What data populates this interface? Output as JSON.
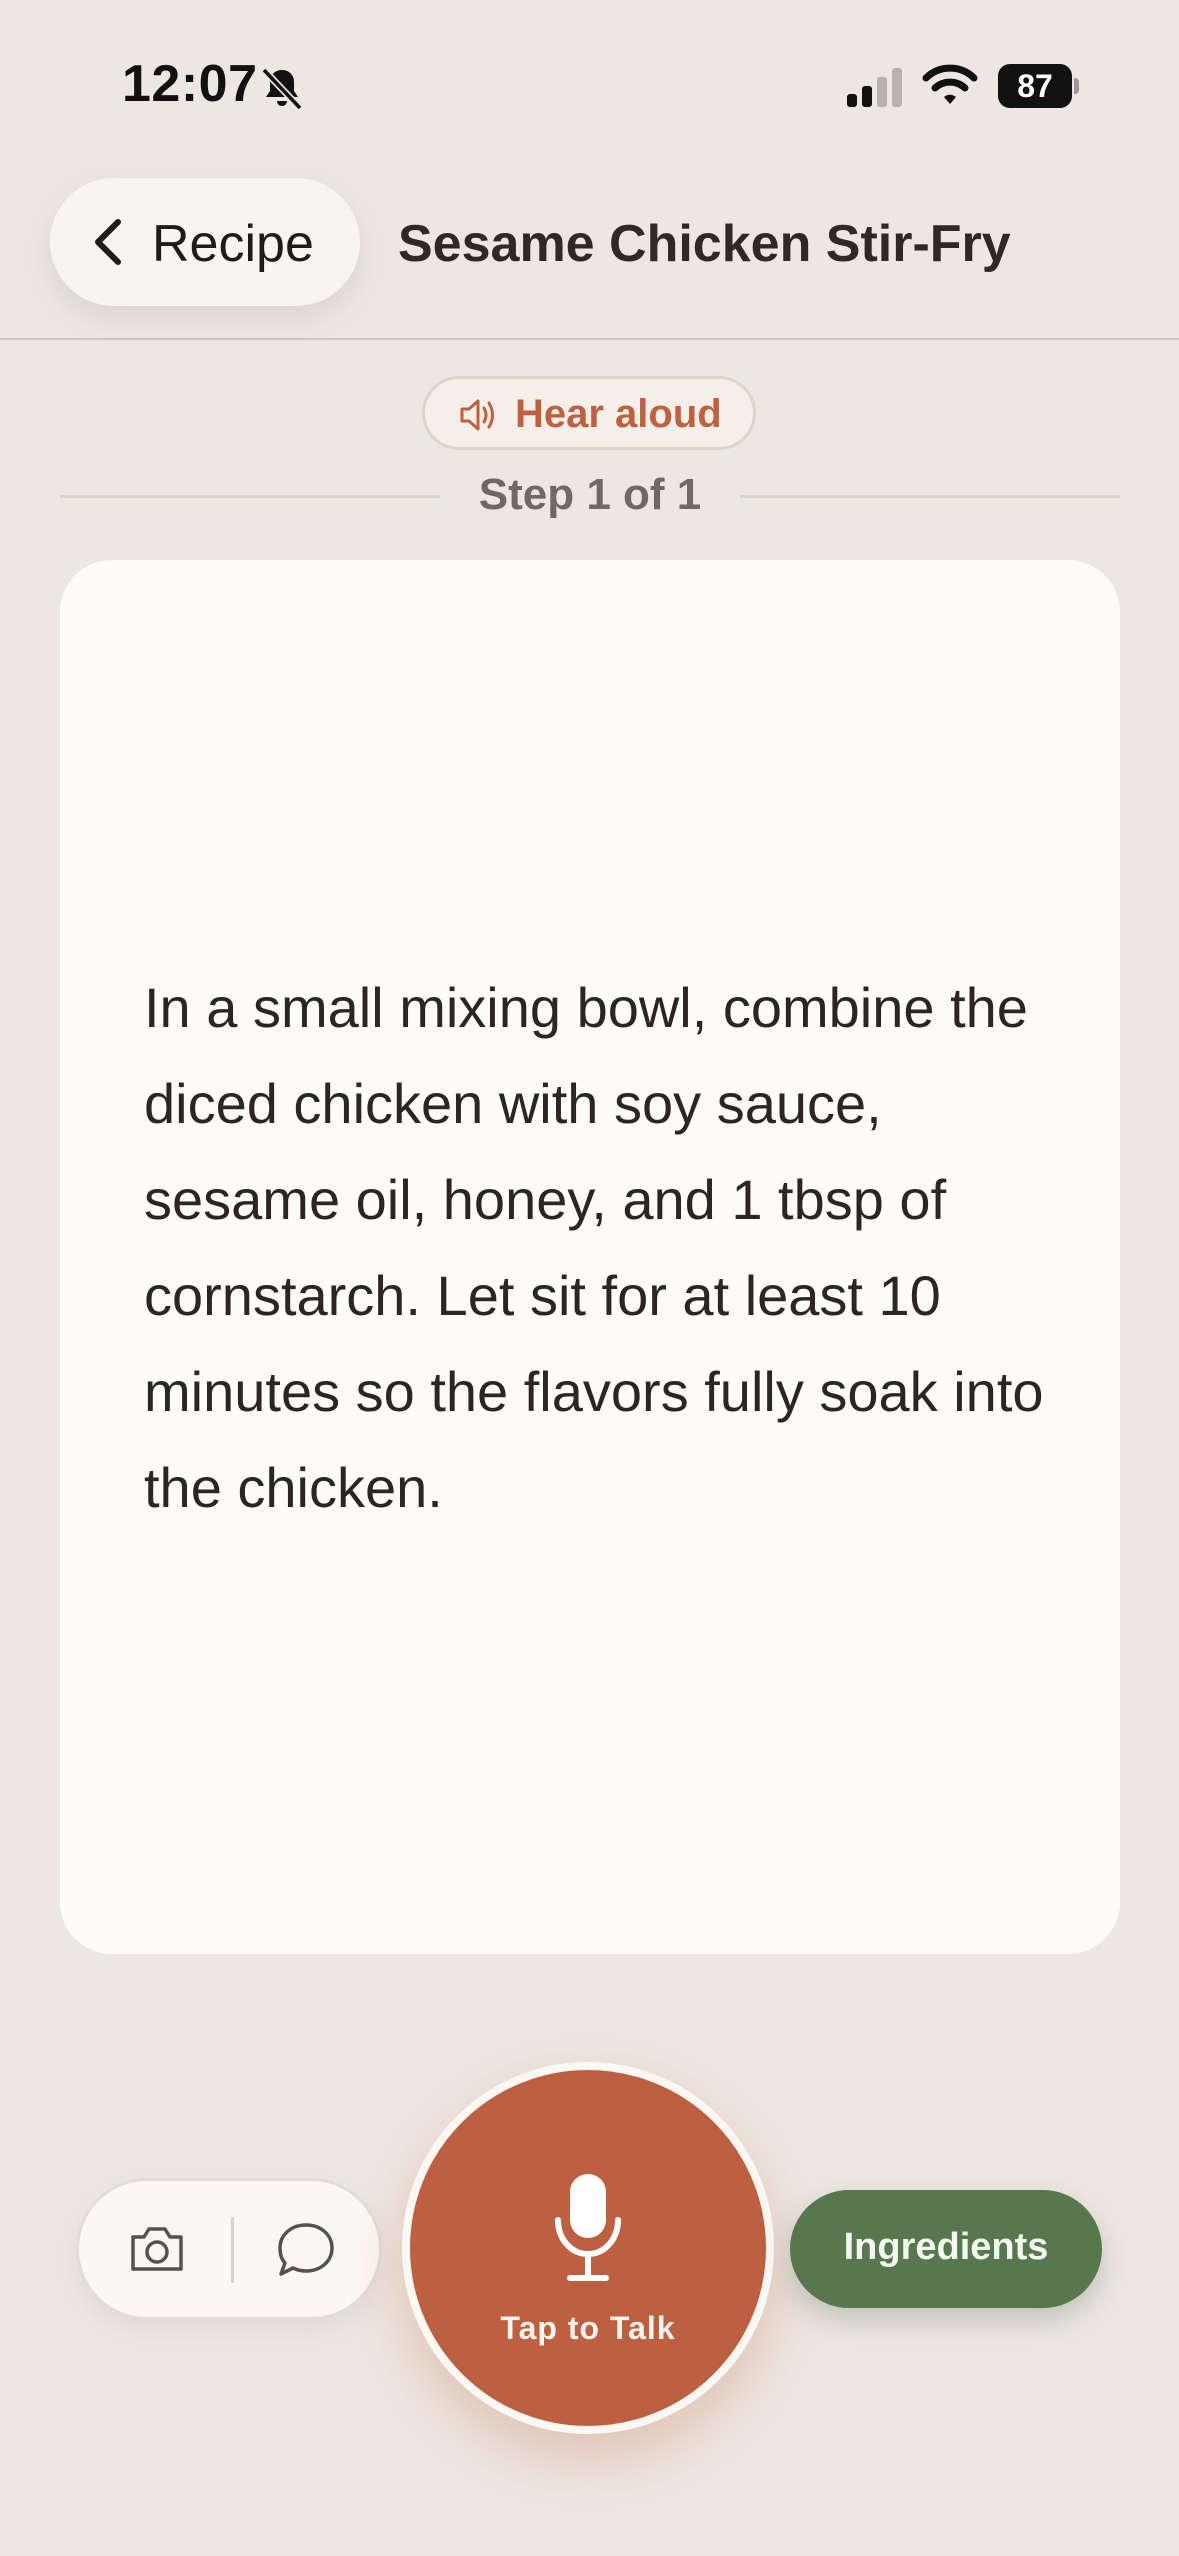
{
  "status_bar": {
    "time": "12:07",
    "battery_level": "87",
    "icons": [
      "bell-slash-icon",
      "cellular-signal-icon",
      "wifi-icon",
      "battery-icon"
    ]
  },
  "header": {
    "back_label": "Recipe",
    "title": "Sesame Chicken Stir-Fry"
  },
  "hear_aloud": {
    "label": "Hear aloud",
    "icon": "speaker-icon"
  },
  "step": {
    "label": "Step 1 of 1",
    "text": "In a small mixing bowl, combine the diced chicken with soy sauce, sesame oil, honey, and 1 tbsp of cornstarch. Let sit for at least 10 minutes so the flavors fully soak into the chicken."
  },
  "bottom_bar": {
    "tools": [
      "camera-icon",
      "chat-bubble-icon"
    ],
    "talk_label": "Tap to Talk",
    "ingredients_label": "Ingredients"
  },
  "colors": {
    "background": "#ede7e2",
    "accent": "#bd6042",
    "card": "#fdfcf9",
    "ingredients_green": "#57774f"
  }
}
